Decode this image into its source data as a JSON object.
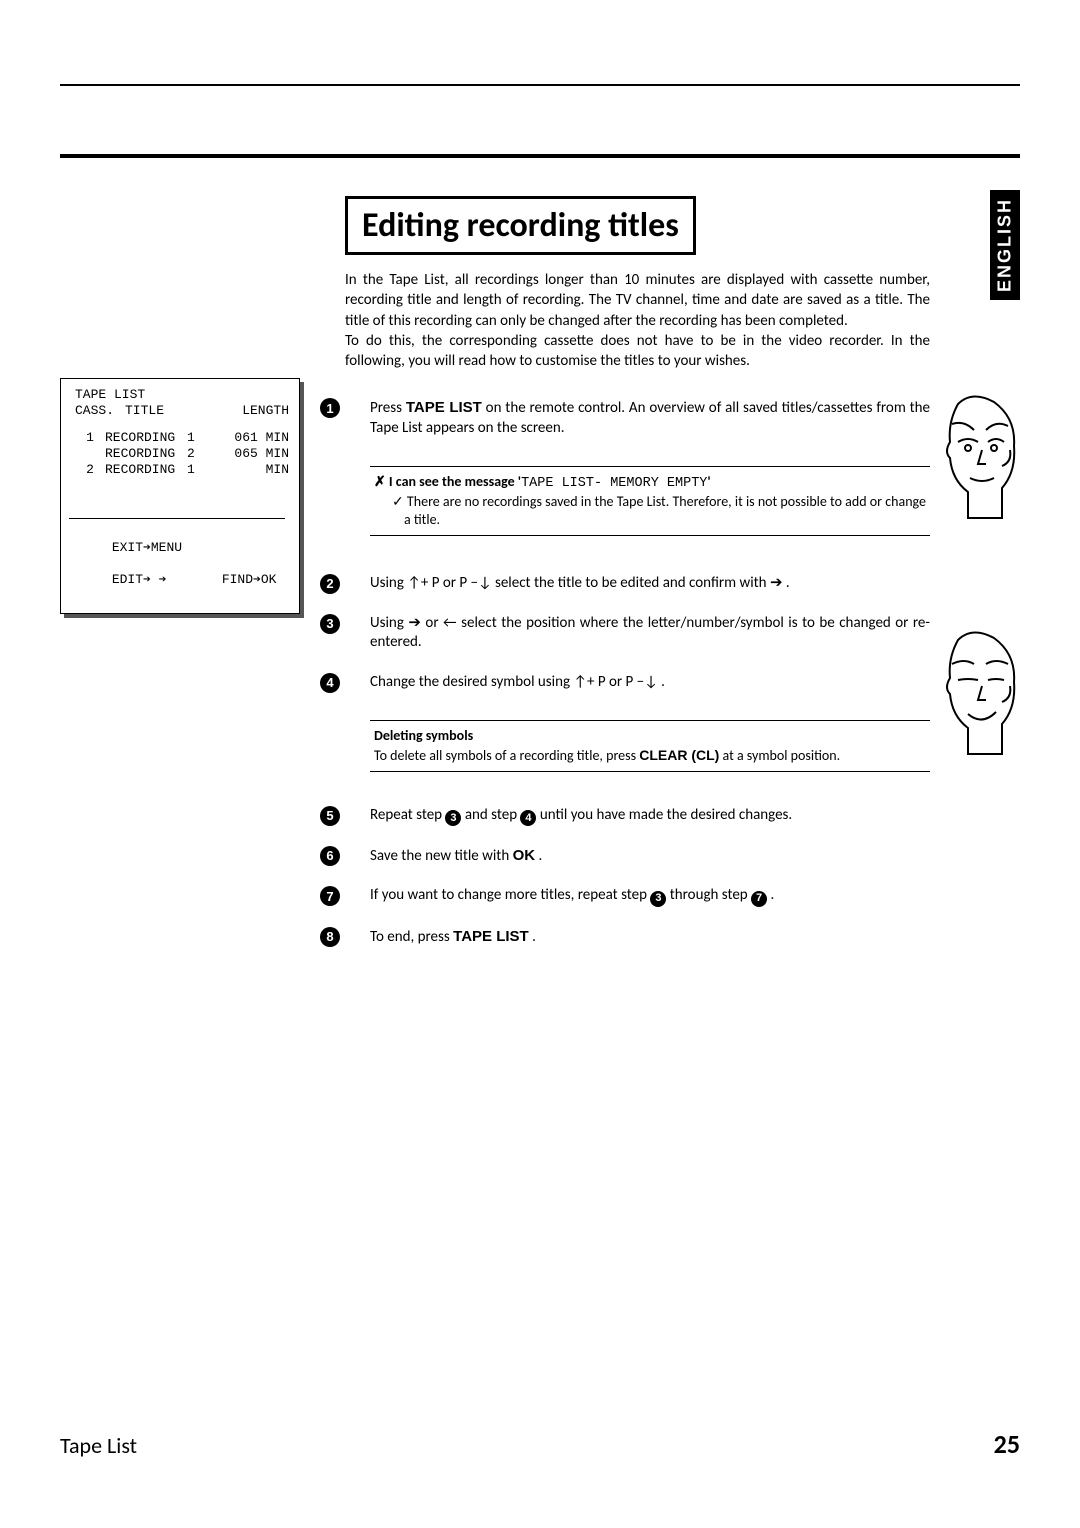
{
  "lang_tab": "ENGLISH",
  "title": "Editing recording titles",
  "intro": "In the Tape List, all recordings longer than 10 minutes are displayed with cassette number, recording title and length of recording. The TV channel, time and date are saved as a title. The title of this recording can only be changed after the recording has been completed.\nTo do this, the corresponding cassette does not have to be in the video recorder. In the following, you will read how to customise the titles to your wishes.",
  "tape_list": {
    "header": "TAPE LIST",
    "col_cass": "CASS.",
    "col_title": "TITLE",
    "col_length": "LENGTH",
    "rows": [
      {
        "cass": "1",
        "title": "RECORDING",
        "num": "1",
        "len": "061 MIN"
      },
      {
        "cass": "",
        "title": "RECORDING",
        "num": "2",
        "len": "065 MIN"
      },
      {
        "cass": "2",
        "title": "RECORDING",
        "num": "1",
        "len": "    MIN"
      }
    ],
    "footer_exit": "EXIT➔MENU",
    "footer_edit": "EDIT➔ ➔",
    "footer_find": "FIND➔OK"
  },
  "steps": {
    "s1": {
      "key": "TAPE LIST",
      "pre": "Press ",
      "post": " on the remote control. An overview of all saved titles/cassettes from the Tape List appears on the screen."
    },
    "s1_callout": {
      "line1a": "✗ I can see the message '",
      "line1b": "TAPE LIST- MEMORY EMPTY",
      "line1c": "'",
      "line2": "✓ There are no recordings saved in the Tape List. Therefore, it is not possible to add or change a title."
    },
    "s2": {
      "text": "Using ↑+ P or  P −↓ select the title to be edited and confirm with ➔ ."
    },
    "s3": {
      "text": "Using ➔ or ← select the position where the letter/number/symbol is to be changed or re-entered."
    },
    "s4": {
      "text": "Change the desired symbol using ↑+ P or  P −↓ ."
    },
    "s4_callout": {
      "title": "Deleting symbols",
      "body_pre": "To delete all symbols of a recording title, press ",
      "key": "CLEAR (CL)",
      "body_post": " at a symbol position."
    },
    "s5": {
      "pre": "Repeat step ",
      "mid": " and step ",
      "post": " until you have made the desired changes."
    },
    "s6": {
      "pre": "Save the new title with ",
      "key": "OK",
      "post": " ."
    },
    "s7": {
      "pre": "If you want to change more titles, repeat step ",
      "mid": " through step ",
      "post": " ."
    },
    "s8": {
      "pre": "To end, press ",
      "key": "TAPE LIST",
      "post": " ."
    }
  },
  "footer_left": "Tape List",
  "footer_page": "25"
}
